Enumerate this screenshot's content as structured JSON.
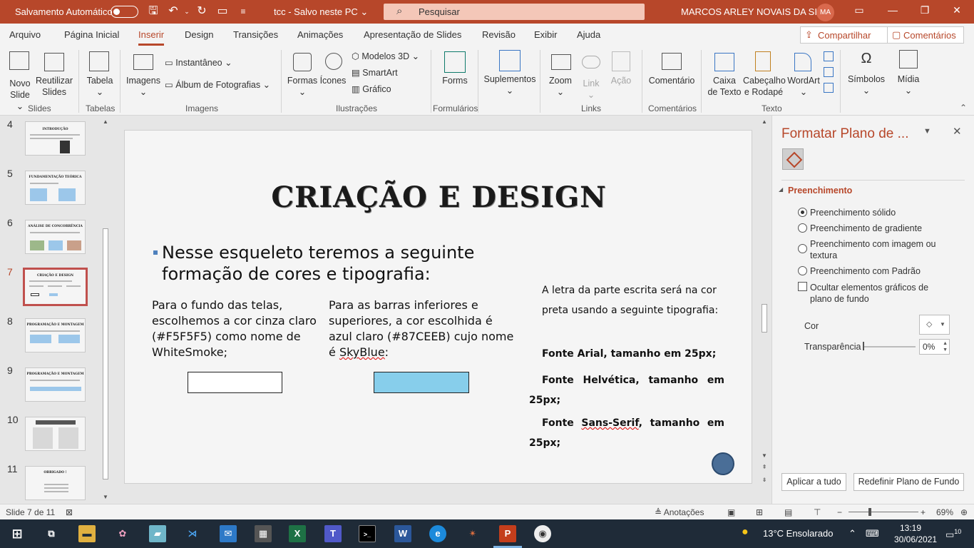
{
  "titlebar": {
    "autosave_label": "Salvamento Automático",
    "doc_title": "tcc  -  Salvo neste PC",
    "search_placeholder": "Pesquisar",
    "user_name": "MARCOS ARLEY NOVAIS DA SILVA",
    "user_initials": "MA"
  },
  "menu": [
    "Arquivo",
    "Página Inicial",
    "Inserir",
    "Design",
    "Transições",
    "Animações",
    "Apresentação de Slides",
    "Revisão",
    "Exibir",
    "Ajuda"
  ],
  "menu_active": "Inserir",
  "share_label": "Compartilhar",
  "comments_label": "Comentários",
  "ribbon": {
    "novo_slide": [
      "Novo",
      "Slide"
    ],
    "reutilizar": [
      "Reutilizar",
      "Slides"
    ],
    "tabela": "Tabela",
    "imagens": "Imagens",
    "instantaneo": "Instantâneo",
    "album": "Álbum de Fotografias",
    "formas": "Formas",
    "icones": "Ícones",
    "modelos3d": "Modelos 3D",
    "smartart": "SmartArt",
    "grafico": "Gráfico",
    "forms": "Forms",
    "suplementos": "Suplementos",
    "zoom": "Zoom",
    "link": "Link",
    "acao": "Ação",
    "comentario": "Comentário",
    "caixa_texto": [
      "Caixa",
      "de Texto"
    ],
    "cabecalho": [
      "Cabeçalho",
      "e Rodapé"
    ],
    "wordart": "WordArt",
    "simbolos": "Símbolos",
    "midia": "Mídia",
    "groups": [
      "Slides",
      "Tabelas",
      "Imagens",
      "Ilustrações",
      "Formulários",
      "Suplementos",
      "Links",
      "Comentários",
      "Texto"
    ]
  },
  "thumbnails": [
    {
      "num": "4",
      "title": "INTRODUÇÃO"
    },
    {
      "num": "5",
      "title": "FUNDAMENTAÇÃO TEÓRICA"
    },
    {
      "num": "6",
      "title": "ANÁLISE DE CONCORRÊNCIA"
    },
    {
      "num": "7",
      "title": "CRIAÇÃO E DESIGN"
    },
    {
      "num": "8",
      "title": "PROGRAMAÇÃO E MONTAGEM"
    },
    {
      "num": "9",
      "title": "PROGRAMAÇÃO E MONTAGEM"
    },
    {
      "num": "10",
      "title": ""
    },
    {
      "num": "11",
      "title": "OBRIGADO !"
    }
  ],
  "thumbnail_active": "7",
  "slide": {
    "title": "CRIAÇÃO E DESIGN",
    "bullet": "Nesse esqueleto teremos a seguinte formação de cores e tipografia:",
    "col1": "Para o fundo das telas, escolhemos a cor cinza claro (#F5F5F5) como nome de WhiteSmoke;",
    "col2_a": "Para as barras inferiores e superiores, a cor escolhida é azul claro (#87CEEB) cujo nome é ",
    "col2_b": "SkyBlue",
    "col2_c": ":",
    "col3_intro": "A letra da parte escrita será na cor preta usando a seguinte tipografia:",
    "font1": "Fonte Arial, tamanho em 25px;",
    "font2": "Fonte Helvética, tamanho em 25px;",
    "font3_a": "Fonte ",
    "font3_b": "Sans-Serif",
    "font3_c": ", tamanho em 25px;",
    "swatch1_color": "#F5F5F5",
    "swatch2_color": "#87CEEB"
  },
  "format_pane": {
    "title": "Formatar Plano de ...",
    "section": "Preenchimento",
    "options": [
      "Preenchimento sólido",
      "Preenchimento de gradiente",
      "Preenchimento com imagem ou textura",
      "Preenchimento com Padrão"
    ],
    "selected_option": "Preenchimento sólido",
    "hide_bg": "Ocultar elementos gráficos de plano de fundo",
    "color_label": "Cor",
    "transparency_label": "Transparência",
    "transparency_value": "0%",
    "apply_all": "Aplicar a tudo",
    "reset_bg": "Redefinir Plano de Fundo"
  },
  "status": {
    "slide_info": "Slide 7 de 11",
    "notes": "Anotações",
    "zoom": "69%"
  },
  "taskbar": {
    "weather": "13°C  Ensolarado",
    "time": "13:19",
    "date": "30/06/2021",
    "notifications": "10"
  },
  "colors": {
    "accent": "#b7472a",
    "selection": "#c0504d"
  }
}
